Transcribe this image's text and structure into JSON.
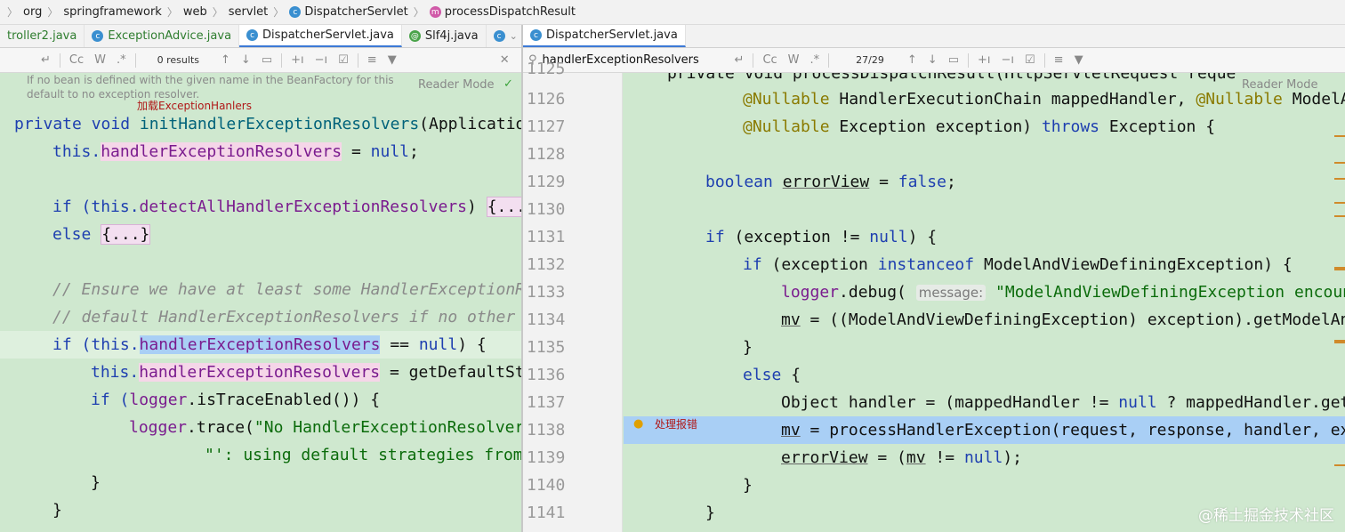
{
  "breadcrumb": [
    "org",
    "springframework",
    "web",
    "servlet",
    "DispatcherServlet",
    "processDispatchResult"
  ],
  "left_tabs": [
    {
      "label": "troller2.java"
    },
    {
      "label": "ExceptionAdvice.java"
    },
    {
      "label": "DispatcherServlet.java"
    },
    {
      "label": "Slf4j.java"
    }
  ],
  "right_tabs": [
    {
      "label": "DispatcherServlet.java"
    }
  ],
  "left_find": {
    "results": "0 results",
    "cc": "Cc",
    "w": "W",
    "star": ".*"
  },
  "right_find": {
    "query": "handlerExceptionResolvers",
    "results": "27/29",
    "cc": "Cc",
    "w": "W",
    "star": ".*"
  },
  "reader_mode": "Reader Mode",
  "left_doc": {
    "tip1": "If no bean is defined with the given name in the BeanFactory for this",
    "tip2": "default to no exception resolver.",
    "annotation": "加载ExceptionHanlers"
  },
  "left_code": {
    "l1a": "private void ",
    "l1b": "initHandlerExceptionResolvers",
    "l1c": "(Application",
    "l2a": "this.",
    "l2b": "handlerExceptionResolvers",
    "l2c": " = ",
    "l2d": "null",
    "l2e": ";",
    "l3a": "if (",
    "l3b": "this.",
    "l3c": "detectAllHandlerExceptionResolvers",
    "l3d": ") ",
    "l3e": "{...}",
    "l4a": "else ",
    "l4b": "{...}",
    "l5": "// Ensure we have at least some HandlerExceptionRe",
    "l6": "// default HandlerExceptionResolvers if no other r",
    "l7a": "if (",
    "l7b": "this.",
    "l7c": "handlerExceptionResolvers",
    "l7d": " == ",
    "l7e": "null",
    "l7f": ") {",
    "l8a": "this.",
    "l8b": "handlerExceptionResolvers",
    "l8c": " = getDefaultStr",
    "l9a": "if (",
    "l9b": "logger",
    "l9c": ".isTraceEnabled()) {",
    "l10a": "logger",
    "l10b": ".trace(",
    "l10c": "\"No HandlerExceptionResolvers",
    "l11": "\"': using default strategies from",
    "l12": "}",
    "l13": "}"
  },
  "right_lines": [
    "1125",
    "1126",
    "1127",
    "1128",
    "1129",
    "1130",
    "1131",
    "1132",
    "1133",
    "1134",
    "1135",
    "1136",
    "1137",
    "1138",
    "1139",
    "1140",
    "1141"
  ],
  "right_code": {
    "l0": "private void processDispatchResult(HttpServletRequest reque",
    "l1a": "@Nullable",
    "l1b": " HandlerExecutionChain mappedHandler, ",
    "l1c": "@Nullable",
    "l1d": " ModelAn",
    "l2a": "@Nullable",
    "l2b": " Exception exception) ",
    "l2c": "throws",
    "l2d": " Exception {",
    "l4a": "boolean ",
    "l4b": "errorView",
    "l4c": " = ",
    "l4d": "false",
    "l4e": ";",
    "l6a": "if",
    "l6b": " (exception != ",
    "l6c": "null",
    "l6d": ") {",
    "l7a": "if",
    "l7b": " (exception ",
    "l7c": "instanceof",
    "l7d": " ModelAndViewDefiningException) {",
    "l8a": "logger",
    "l8b": ".debug( ",
    "l8c": "message:",
    "l8d": " \"ModelAndViewDefiningException encounte",
    "l9a": "mv",
    "l9b": " = ((ModelAndViewDefiningException) exception).getModelAnd",
    "l10": "}",
    "l11a": "else",
    "l11b": " {",
    "l12a": "Object handler = (mappedHandler != ",
    "l12b": "null",
    "l12c": " ? mappedHandler.getH",
    "l13a": "mv",
    "l13b": " = processHandlerException(request, response, handler, exc",
    "l14a": "errorView",
    "l14b": " = (",
    "l14c": "mv",
    "l14d": " != ",
    "l14e": "null",
    "l14f": ");",
    "l15": "}",
    "l16": "}"
  },
  "gutter_note": "处理报错",
  "watermark": "@稀土掘金技术社区",
  "colors": {
    "editor_bg": "#cfe8cf",
    "highlight_blue": "#a9cff5",
    "keyword": "#1e3fb0",
    "string": "#0b6b0b"
  }
}
